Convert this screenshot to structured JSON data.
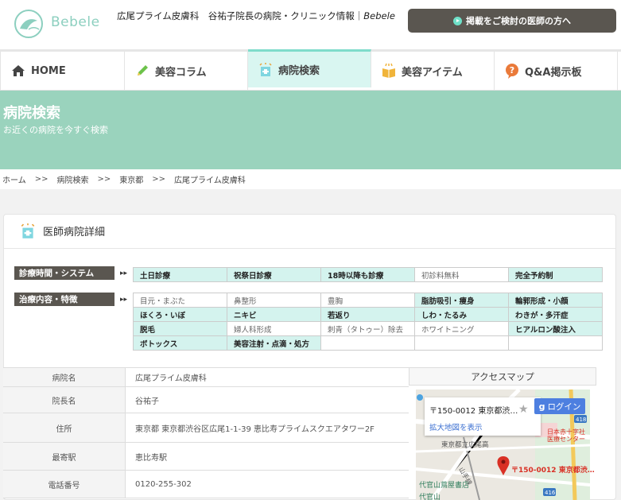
{
  "header": {
    "logo_text": "Bebele",
    "site_title": "広尾プライム皮膚科　谷祐子院長の病院・クリニック情報｜",
    "site_brand": "Bebele",
    "cta_label": "掲載をご検討の医師の方へ"
  },
  "nav": {
    "items": [
      {
        "label": "HOME",
        "icon": "home-icon"
      },
      {
        "label": "美容コラム",
        "icon": "pencil-icon"
      },
      {
        "label": "病院検索",
        "icon": "hospital-icon"
      },
      {
        "label": "美容アイテム",
        "icon": "book-icon"
      },
      {
        "label": "Q&A掲示板",
        "icon": "question-icon"
      }
    ],
    "active_index": 2
  },
  "hero": {
    "title": "病院検索",
    "subtitle": "お近くの病院を今すぐ検索"
  },
  "breadcrumb": [
    "ホーム",
    "病院検索",
    "東京都",
    "広尾プライム皮膚科"
  ],
  "breadcrumb_sep": ">>",
  "section": {
    "title": "医師病院詳細"
  },
  "system": {
    "label": "診療時間・システム",
    "tags": [
      {
        "text": "土日診療",
        "on": true
      },
      {
        "text": "祝祭日診療",
        "on": true
      },
      {
        "text": "18時以降も診療",
        "on": true
      },
      {
        "text": "初診料無料",
        "on": false
      },
      {
        "text": "完全予約制",
        "on": true
      }
    ]
  },
  "treatments": {
    "label": "治療内容・特徴",
    "tags": [
      {
        "text": "目元・まぶた",
        "on": false
      },
      {
        "text": "鼻整形",
        "on": false
      },
      {
        "text": "豊胸",
        "on": false
      },
      {
        "text": "脂肪吸引・痩身",
        "on": true
      },
      {
        "text": "輪郭形成・小顔",
        "on": true
      },
      {
        "text": "ほくろ・いぼ",
        "on": true
      },
      {
        "text": "ニキビ",
        "on": true
      },
      {
        "text": "若返り",
        "on": true
      },
      {
        "text": "しわ・たるみ",
        "on": true
      },
      {
        "text": "わきが・多汗症",
        "on": true
      },
      {
        "text": "脱毛",
        "on": true
      },
      {
        "text": "婦人科形成",
        "on": false
      },
      {
        "text": "刺青（タトゥー）除去",
        "on": false
      },
      {
        "text": "ホワイトニング",
        "on": false
      },
      {
        "text": "ヒアルロン酸注入",
        "on": true
      },
      {
        "text": "ボトックス",
        "on": true
      },
      {
        "text": "美容注射・点滴・処方",
        "on": true
      }
    ]
  },
  "info": [
    {
      "key": "病院名",
      "value": "広尾プライム皮膚科"
    },
    {
      "key": "院長名",
      "value": "谷祐子"
    },
    {
      "key": "住所",
      "value": "東京都 東京都渋谷区広尾1-1-39 恵比寿プライムスクエアタワー2F"
    },
    {
      "key": "最寄駅",
      "value": "恵比寿駅"
    },
    {
      "key": "電話番号",
      "value": "0120-255-302"
    }
  ],
  "map": {
    "heading": "アクセスマップ",
    "card_address": "〒150-0012 東京都渋…",
    "card_link": "拡大地図を表示",
    "login_label": "ログイン",
    "pin_label": "〒150-0012 東京都渋…",
    "labels": [
      "東京都立広尾高",
      "日本赤十字社",
      "医療センター",
      "山手線",
      "代官山蔦屋書店",
      "代官山",
      "418",
      "416"
    ]
  },
  "colors": {
    "accent": "#9ad3bd",
    "tag_on": "#d4f3ee",
    "dark_label": "#5a5650",
    "cta": "#5a5650"
  }
}
